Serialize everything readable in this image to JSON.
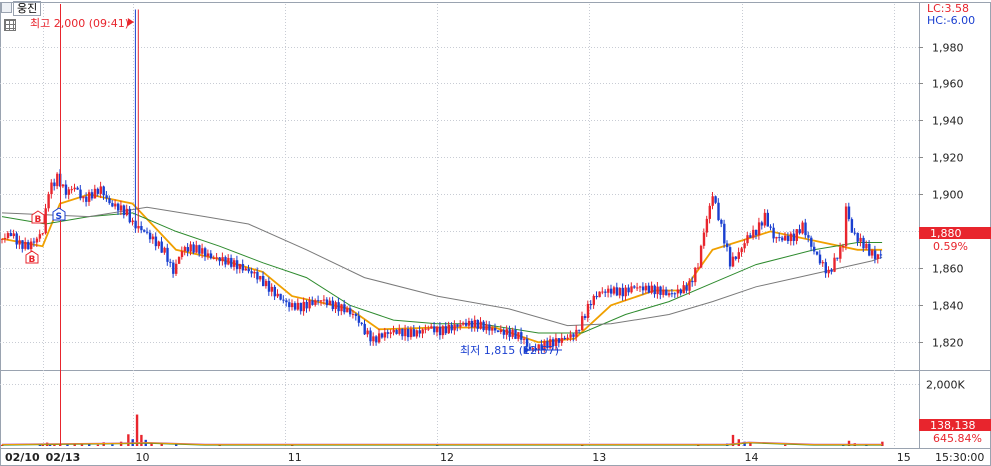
{
  "header": {
    "stock_tab_label": "웅진",
    "lc_label": "LC:3.58",
    "hc_label": "HC:-6.00",
    "colors": {
      "up": "#e8252d",
      "down": "#1a3fd0",
      "lc": "#e8252d",
      "hc": "#1a3fd0"
    }
  },
  "chart_data": {
    "type": "candlestick",
    "price_axis": {
      "ticks": [
        "1,980",
        "1,960",
        "1,940",
        "1,920",
        "1,900",
        "1,880",
        "1,860",
        "1,840",
        "1,820"
      ],
      "tick_values": [
        1980,
        1960,
        1940,
        1920,
        1900,
        1880,
        1860,
        1840,
        1820
      ],
      "ylim": [
        1805,
        2003
      ]
    },
    "volume_axis": {
      "ticks": [
        "2,000K"
      ],
      "tick_values": [
        2000
      ]
    },
    "x_axis": {
      "labels": [
        "02/10",
        "02/13",
        "10",
        "11",
        "12",
        "13",
        "14",
        "15",
        "15:30:00"
      ],
      "label_positions_min": [
        0,
        28,
        90,
        195,
        300,
        405,
        510,
        615,
        null
      ]
    },
    "current_price": {
      "value": 1880,
      "label": "1,880",
      "change_label": "0.59%"
    },
    "current_volume": {
      "label": "138,138",
      "change_label": "645.84%"
    },
    "annotations": {
      "high": {
        "label": "최고 2,000 (09:41)",
        "value": 2000
      },
      "low": {
        "label": "최저 1,815 (12:57)",
        "value": 1815
      },
      "signals": [
        "B",
        "S",
        "B"
      ]
    },
    "price_path": [
      [
        0,
        1876
      ],
      [
        6,
        1879
      ],
      [
        12,
        1873
      ],
      [
        18,
        1872
      ],
      [
        24,
        1876
      ],
      [
        28,
        1880
      ],
      [
        32,
        1902
      ],
      [
        38,
        1909
      ],
      [
        44,
        1901
      ],
      [
        50,
        1904
      ],
      [
        56,
        1897
      ],
      [
        62,
        1900
      ],
      [
        68,
        1903
      ],
      [
        74,
        1895
      ],
      [
        80,
        1893
      ],
      [
        86,
        1890
      ],
      [
        90,
        1884
      ],
      [
        98,
        1880
      ],
      [
        106,
        1874
      ],
      [
        112,
        1869
      ],
      [
        118,
        1858
      ],
      [
        124,
        1870
      ],
      [
        130,
        1871
      ],
      [
        136,
        1870
      ],
      [
        144,
        1866
      ],
      [
        150,
        1865
      ],
      [
        158,
        1863
      ],
      [
        166,
        1860
      ],
      [
        174,
        1857
      ],
      [
        182,
        1851
      ],
      [
        190,
        1845
      ],
      [
        198,
        1840
      ],
      [
        206,
        1839
      ],
      [
        212,
        1841
      ],
      [
        220,
        1843
      ],
      [
        228,
        1840
      ],
      [
        236,
        1838
      ],
      [
        244,
        1834
      ],
      [
        250,
        1826
      ],
      [
        256,
        1821
      ],
      [
        262,
        1824
      ],
      [
        270,
        1826
      ],
      [
        278,
        1825
      ],
      [
        286,
        1825
      ],
      [
        294,
        1828
      ],
      [
        302,
        1826
      ],
      [
        310,
        1828
      ],
      [
        318,
        1830
      ],
      [
        326,
        1830
      ],
      [
        334,
        1828
      ],
      [
        342,
        1826
      ],
      [
        350,
        1825
      ],
      [
        358,
        1823
      ],
      [
        364,
        1816
      ],
      [
        372,
        1818
      ],
      [
        380,
        1820
      ],
      [
        388,
        1822
      ],
      [
        396,
        1825
      ],
      [
        400,
        1832
      ],
      [
        406,
        1842
      ],
      [
        412,
        1847
      ],
      [
        420,
        1848
      ],
      [
        428,
        1847
      ],
      [
        436,
        1850
      ],
      [
        444,
        1849
      ],
      [
        452,
        1848
      ],
      [
        460,
        1846
      ],
      [
        468,
        1848
      ],
      [
        474,
        1851
      ],
      [
        480,
        1862
      ],
      [
        484,
        1880
      ],
      [
        490,
        1900
      ],
      [
        496,
        1882
      ],
      [
        502,
        1863
      ],
      [
        508,
        1868
      ],
      [
        514,
        1877
      ],
      [
        520,
        1880
      ],
      [
        526,
        1888
      ],
      [
        532,
        1877
      ],
      [
        538,
        1876
      ],
      [
        546,
        1877
      ],
      [
        552,
        1883
      ],
      [
        558,
        1872
      ],
      [
        564,
        1864
      ],
      [
        570,
        1857
      ],
      [
        576,
        1867
      ],
      [
        580,
        1873
      ],
      [
        582,
        1893
      ],
      [
        586,
        1880
      ],
      [
        590,
        1876
      ],
      [
        594,
        1873
      ],
      [
        598,
        1869
      ],
      [
        603,
        1866
      ],
      [
        607,
        1868
      ]
    ],
    "high_time_min": 93,
    "low_time_min": 366,
    "series": [
      {
        "name": "",
        "color": "#f0a000",
        "values": [
          [
            0,
            1876
          ],
          [
            28,
            1872
          ],
          [
            40,
            1895
          ],
          [
            60,
            1900
          ],
          [
            90,
            1895
          ],
          [
            120,
            1870
          ],
          [
            150,
            1865
          ],
          [
            180,
            1858
          ],
          [
            200,
            1845
          ],
          [
            240,
            1838
          ],
          [
            260,
            1827
          ],
          [
            300,
            1828
          ],
          [
            340,
            1828
          ],
          [
            370,
            1820
          ],
          [
            395,
            1822
          ],
          [
            420,
            1840
          ],
          [
            450,
            1848
          ],
          [
            470,
            1848
          ],
          [
            490,
            1870
          ],
          [
            510,
            1875
          ],
          [
            530,
            1880
          ],
          [
            560,
            1875
          ],
          [
            590,
            1870
          ],
          [
            607,
            1870
          ]
        ]
      },
      {
        "name": "",
        "color": "#2e8b2e",
        "values": [
          [
            0,
            1888
          ],
          [
            30,
            1884
          ],
          [
            60,
            1888
          ],
          [
            90,
            1890
          ],
          [
            120,
            1880
          ],
          [
            150,
            1872
          ],
          [
            180,
            1863
          ],
          [
            210,
            1855
          ],
          [
            240,
            1840
          ],
          [
            270,
            1832
          ],
          [
            300,
            1830
          ],
          [
            330,
            1830
          ],
          [
            370,
            1825
          ],
          [
            400,
            1825
          ],
          [
            430,
            1835
          ],
          [
            460,
            1842
          ],
          [
            490,
            1852
          ],
          [
            520,
            1862
          ],
          [
            560,
            1870
          ],
          [
            590,
            1874
          ],
          [
            607,
            1874
          ]
        ]
      },
      {
        "name": "",
        "color": "#7a7a7a",
        "values": [
          [
            0,
            1890
          ],
          [
            60,
            1888
          ],
          [
            100,
            1893
          ],
          [
            140,
            1888
          ],
          [
            170,
            1884
          ],
          [
            210,
            1870
          ],
          [
            250,
            1855
          ],
          [
            300,
            1845
          ],
          [
            350,
            1838
          ],
          [
            390,
            1829
          ],
          [
            420,
            1830
          ],
          [
            460,
            1835
          ],
          [
            490,
            1842
          ],
          [
            520,
            1850
          ],
          [
            560,
            1857
          ],
          [
            600,
            1864
          ],
          [
            607,
            1866
          ]
        ]
      }
    ],
    "volume": [
      [
        0,
        40
      ],
      [
        26,
        60
      ],
      [
        28,
        80
      ],
      [
        31,
        110
      ],
      [
        33,
        60
      ],
      [
        36,
        70
      ],
      [
        40,
        80
      ],
      [
        45,
        50
      ],
      [
        50,
        90
      ],
      [
        55,
        70
      ],
      [
        60,
        60
      ],
      [
        66,
        40
      ],
      [
        70,
        120
      ],
      [
        76,
        50
      ],
      [
        82,
        140
      ],
      [
        87,
        380
      ],
      [
        90,
        220
      ],
      [
        93,
        1020
      ],
      [
        96,
        360
      ],
      [
        99,
        200
      ],
      [
        103,
        90
      ],
      [
        110,
        70
      ],
      [
        120,
        50
      ],
      [
        150,
        40
      ],
      [
        200,
        40
      ],
      [
        300,
        40
      ],
      [
        400,
        40
      ],
      [
        480,
        50
      ],
      [
        500,
        80
      ],
      [
        504,
        360
      ],
      [
        508,
        220
      ],
      [
        512,
        140
      ],
      [
        516,
        90
      ],
      [
        540,
        40
      ],
      [
        580,
        50
      ],
      [
        584,
        170
      ],
      [
        588,
        90
      ],
      [
        596,
        40
      ],
      [
        607,
        140
      ]
    ]
  }
}
